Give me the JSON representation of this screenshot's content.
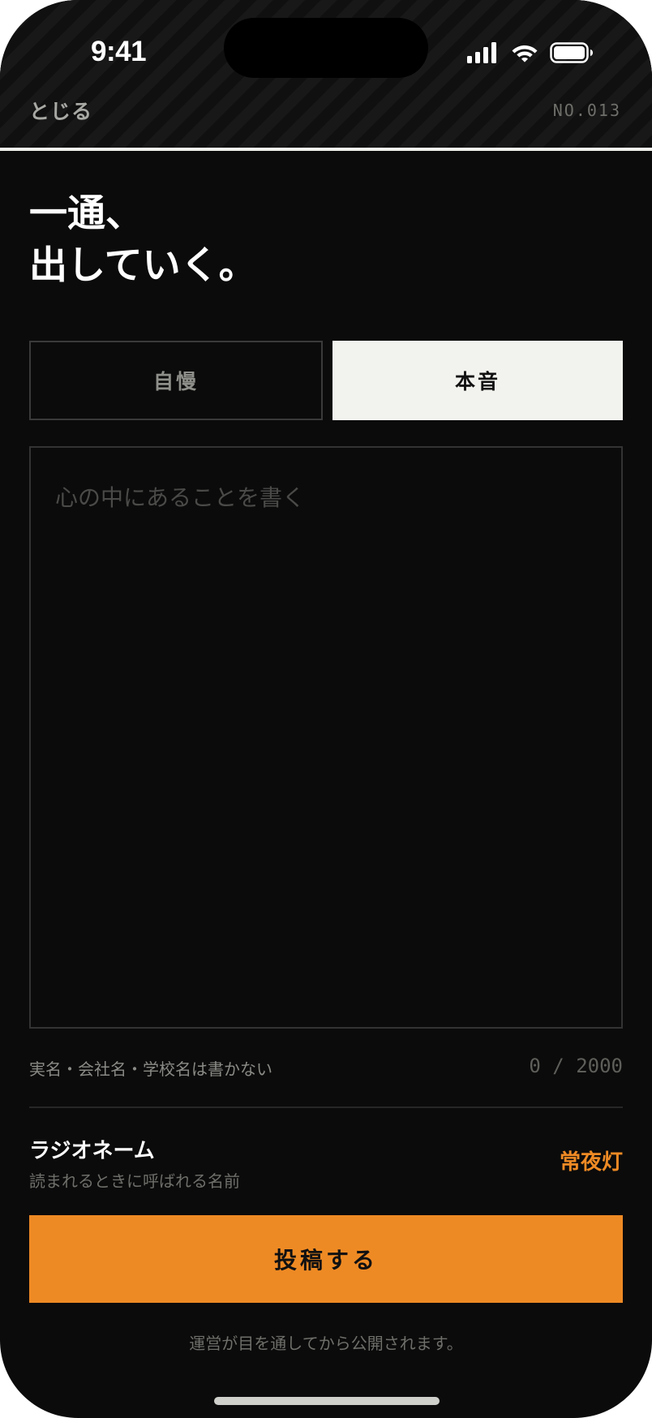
{
  "status_bar": {
    "time": "9:41",
    "icons": [
      "cellular-signal-icon",
      "wifi-icon",
      "battery-icon"
    ]
  },
  "header": {
    "close_label": "とじる",
    "post_number": "NO.013"
  },
  "headline": {
    "line1": "一通、",
    "line2": "出していく。"
  },
  "tabs": [
    {
      "label": "自慢",
      "selected": false
    },
    {
      "label": "本音",
      "selected": true
    }
  ],
  "composer": {
    "value": "",
    "placeholder": "心の中にあることを書く",
    "hint": "実名・会社名・学校名は書かない",
    "counter": "0 / 2000"
  },
  "radio_name": {
    "label": "ラジオネーム",
    "sublabel": "読まれるときに呼ばれる名前",
    "value": "常夜灯"
  },
  "submit": {
    "label": "投稿する"
  },
  "footer_note": "運営が目を通してから公開されます。",
  "colors": {
    "background": "#0b0b0b",
    "accent": "#ee8a24",
    "selected_tab": "#f2f2ee",
    "border": "#333333"
  }
}
